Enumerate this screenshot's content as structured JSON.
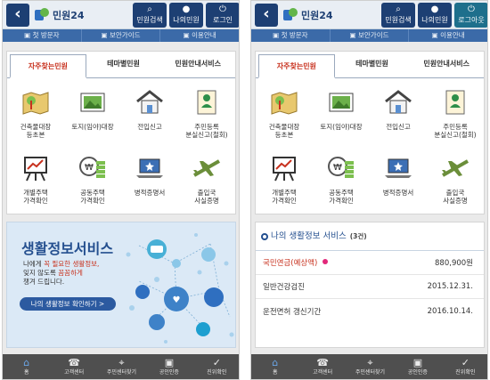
{
  "app": {
    "logo_text": "민원24",
    "back_icon": "chevron-left-icon",
    "top_buttons": [
      {
        "label": "민원검색",
        "icon": "search-icon",
        "glyph": "🔍"
      },
      {
        "label": "나의민원",
        "icon": "person-icon",
        "glyph": "👤"
      },
      {
        "label": "로그인",
        "icon": "power-icon",
        "glyph": "⏻"
      }
    ],
    "top_buttons_right": [
      {
        "label": "민원검색",
        "icon": "search-icon",
        "glyph": "🔍"
      },
      {
        "label": "나의민원",
        "icon": "person-icon",
        "glyph": "👤"
      },
      {
        "label": "로그아웃",
        "icon": "power-icon",
        "glyph": "⏻"
      }
    ],
    "subnav": [
      "첫 방문자",
      "보안가이드",
      "이용안내"
    ]
  },
  "menu": {
    "tabs": [
      "자주찾는민원",
      "테마별민원",
      "민원안내서비스"
    ],
    "active_tab": 0,
    "items": [
      {
        "label": "건축물대장\n등초본",
        "icon": "building-map-icon"
      },
      {
        "label": "토지(임야)대장",
        "icon": "land-photo-icon"
      },
      {
        "label": "전입신고",
        "icon": "house-icon"
      },
      {
        "label": "주민등록\n분실신고(철회)",
        "icon": "id-document-icon"
      },
      {
        "label": "개별주택\n가격확인",
        "icon": "price-chart-icon"
      },
      {
        "label": "공동주택\n가격확인",
        "icon": "coins-icon"
      },
      {
        "label": "병적증명서",
        "icon": "laptop-star-icon"
      },
      {
        "label": "출입국\n사실증명",
        "icon": "airplane-icon"
      }
    ]
  },
  "service_banner": {
    "title": "생활정보서비스",
    "line1_a": "나에게 ",
    "line1_b": "꼭 필요한 생활정보,",
    "line2_a": "잊지 않도록 ",
    "line2_b": "꼼꼼하게",
    "line3": "챙겨 드립니다.",
    "button": "나의 생활정보 확인하기 >"
  },
  "my_info": {
    "title": "나의 생활정보 서비스",
    "count": "(3건)",
    "rows": [
      {
        "name": "국민연금(예상액)",
        "value": "880,900원",
        "highlight": true
      },
      {
        "name": "일반건강검진",
        "value": "2015.12.31."
      },
      {
        "name": "운전면허 갱신기간",
        "value": "2016.10.14."
      }
    ]
  },
  "bottom_nav": [
    {
      "label": "홈",
      "icon": "home-icon",
      "glyph": "⌂"
    },
    {
      "label": "고객센터",
      "icon": "headset-icon",
      "glyph": "☎"
    },
    {
      "label": "주민센터찾기",
      "icon": "location-icon",
      "glyph": "⌖"
    },
    {
      "label": "공인인증",
      "icon": "lock-icon",
      "glyph": "🔒"
    },
    {
      "label": "진위확인",
      "icon": "document-check-icon",
      "glyph": "✓"
    }
  ],
  "colors": {
    "primary": "#1d3f73",
    "subnav": "#3b6aa8",
    "accent_red": "#c8321f",
    "pin_pink": "#e2287a",
    "bottom_bar": "#4f4f4f"
  }
}
